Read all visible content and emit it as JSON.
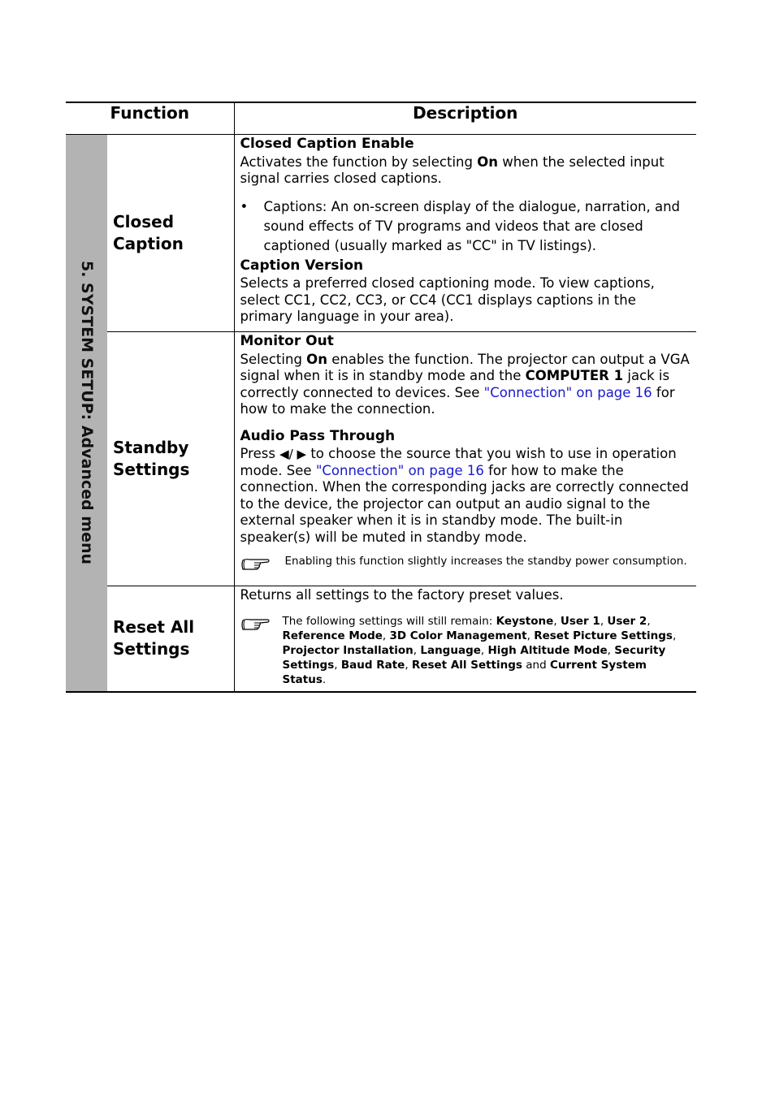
{
  "table": {
    "headers": {
      "function": "Function",
      "description": "Description"
    },
    "side_label": {
      "section": "5. SYSTEM SETUP",
      "sep": ": ",
      "menu": "Advanced menu"
    },
    "rows": [
      {
        "function": "Closed Caption",
        "sections": {
          "enable_title": "Closed Caption Enable",
          "enable_text_1": "Activates the function by selecting ",
          "enable_bold": "On",
          "enable_text_2": " when the selected input signal carries closed captions.",
          "bullet_symbol": "•",
          "bullet_text": "Captions: An on-screen display of the dialogue, narration, and sound effects of TV programs and videos that are closed captioned (usually marked as \"CC\" in TV listings).",
          "version_title": "Caption Version",
          "version_text": "Selects a preferred closed captioning mode. To view captions, select CC1, CC2, CC3, or CC4 (CC1 displays captions in the primary language in your area)."
        }
      },
      {
        "function": "Standby Settings",
        "sections": {
          "monitor_title": "Monitor Out",
          "monitor_t1": "Selecting ",
          "monitor_b1": "On",
          "monitor_t2": " enables the function. The projector can output a VGA signal when it is in standby mode and the ",
          "monitor_b2": "COMPUTER 1",
          "monitor_t3": " jack is correctly connected to devices. See ",
          "monitor_link": "\"Connection\" on page 16",
          "monitor_t4": " for how to make the connection.",
          "audio_title": "Audio Pass Through",
          "audio_t1": "Press ",
          "audio_arrows": "◀/ ▶",
          "audio_t2": " to choose the source that you wish to use in operation mode. See ",
          "audio_link": "\"Connection\" on page 16",
          "audio_t3": " for how to make the connection. When the corresponding jacks are correctly connected to the device, the projector can output an audio signal to the external speaker when it is in standby mode. The built-in speaker(s) will be muted in standby mode.",
          "note_icon": "pointing-hand-icon",
          "note_text": "Enabling this function slightly increases the standby power consumption."
        }
      },
      {
        "function": "Reset All Settings",
        "sections": {
          "text": "Returns all settings to the factory preset values.",
          "note_icon": "pointing-hand-icon",
          "note_intro": "The following settings will still remain: ",
          "items": [
            "Keystone",
            "User 1",
            "User 2",
            "Reference Mode",
            "3D Color Management",
            "Reset Picture Settings",
            "Projector Installation",
            "Language",
            "High Altitude Mode",
            "Security Settings",
            "Baud Rate",
            "Reset All Settings",
            "Current System Status"
          ],
          "sep": ", ",
          "and": " and ",
          "end": "."
        }
      }
    ]
  }
}
